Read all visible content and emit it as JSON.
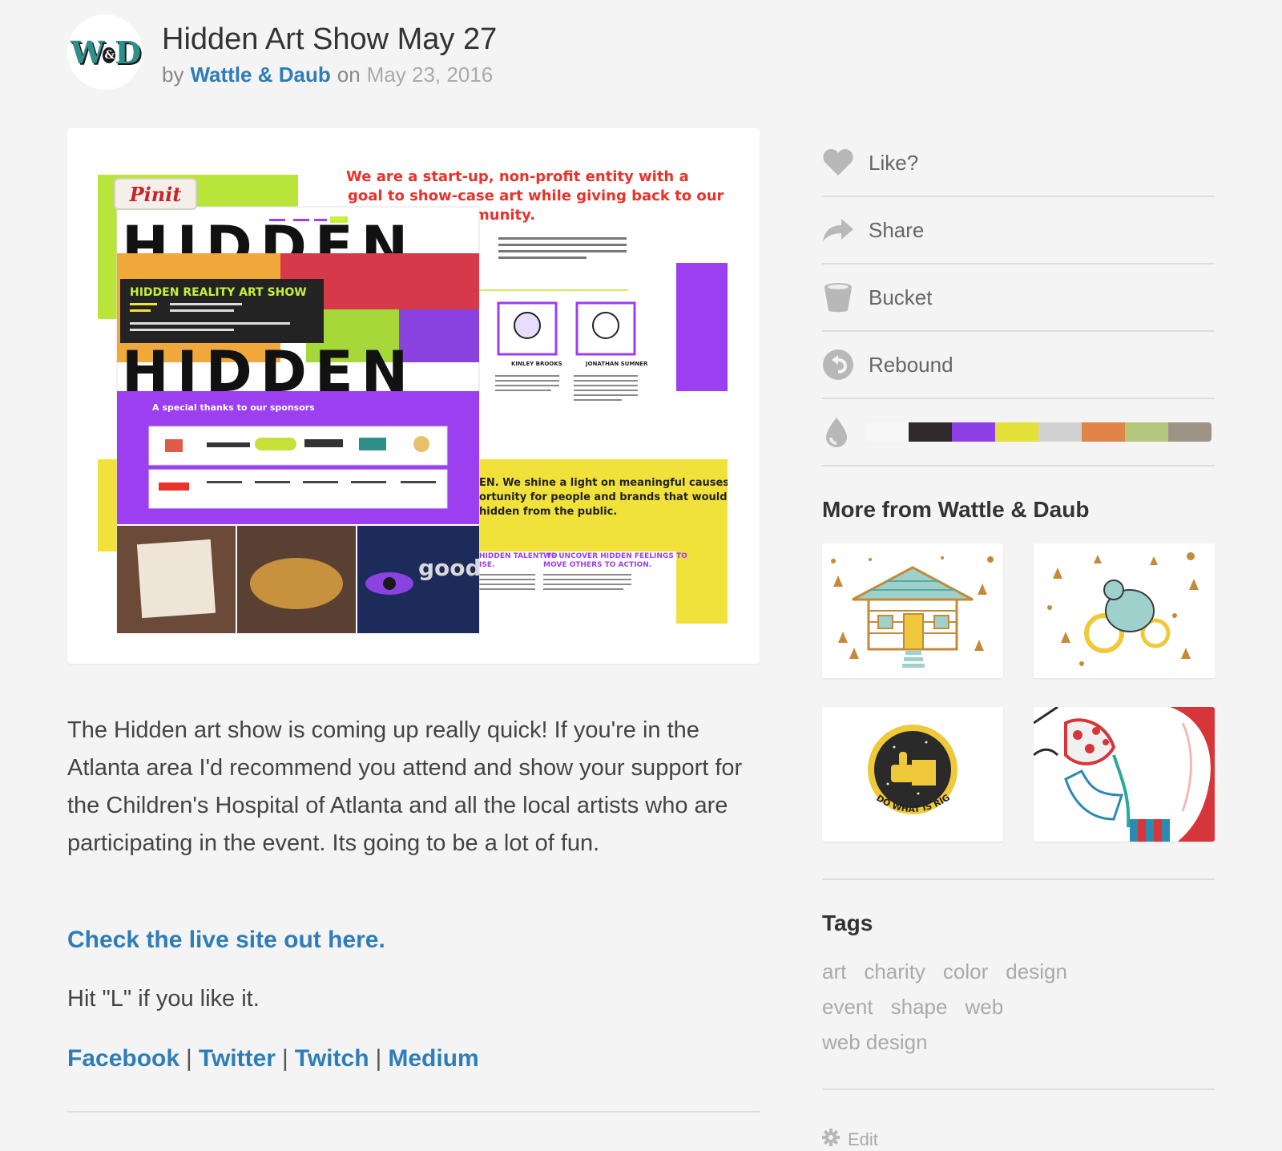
{
  "shot": {
    "title": "Hidden Art Show May 27",
    "by_label": "by",
    "author": "Wattle & Daub",
    "on_label": "on",
    "date": "May 23, 2016",
    "avatar_text": "W&D"
  },
  "image": {
    "pin_label": "Pinit",
    "mock": {
      "headline": "We are a start-up, non-profit entity with a goal to show-case art while giving back to our community.",
      "hidden_word": "HIDDEN",
      "show_title": "HIDDEN REALITY ART SHOW",
      "sponsors_heading": "A special thanks to our sponsors",
      "shine": "EN. We shine a light on meaningful causes ortunity for people and brands that would hidden from the public.",
      "person1": "KINLEY BROOKS",
      "person2": "JONATHAN SUMNER",
      "feelings": "WE UNCOVER HIDDEN FEELINGS TO MOVE OTHERS TO ACTION."
    }
  },
  "description": {
    "body": "The Hidden art show is coming up really quick! If you're in the Atlanta area I'd recommend you attend and show your support for the Children's Hospital of Atlanta and all the local artists who are participating in the event. Its going to be a lot of fun.",
    "live_link": "Check the live site out here.",
    "hit_l": "Hit \"L\" if you like it."
  },
  "social": [
    "Facebook",
    "Twitter",
    "Twitch",
    "Medium"
  ],
  "social_sep": "|",
  "actions": [
    {
      "label": "Like?",
      "icon": "heart-icon"
    },
    {
      "label": "Share",
      "icon": "share-arrow-icon"
    },
    {
      "label": "Bucket",
      "icon": "bucket-icon"
    },
    {
      "label": "Rebound",
      "icon": "rebound-icon"
    }
  ],
  "palette_icon": "color-drop-icon",
  "palette": [
    "#f7f7f7",
    "#302a2c",
    "#8e3fe6",
    "#e4e03a",
    "#d2d2d2",
    "#e0844a",
    "#b5c77e",
    "#9d9486"
  ],
  "more": {
    "title": "More from Wattle & Daub",
    "thumbs": [
      "cabin-illustration",
      "bear-on-bike-illustration",
      "do-what-is-right-always-badge",
      "polka-dot-character-illustration"
    ],
    "badge_text": "DO WHAT IS RIGHT ALWAYS"
  },
  "tags": {
    "title": "Tags",
    "items": [
      "art",
      "charity",
      "color",
      "design",
      "event",
      "shape",
      "web",
      "web design"
    ]
  },
  "edit_label": "Edit"
}
